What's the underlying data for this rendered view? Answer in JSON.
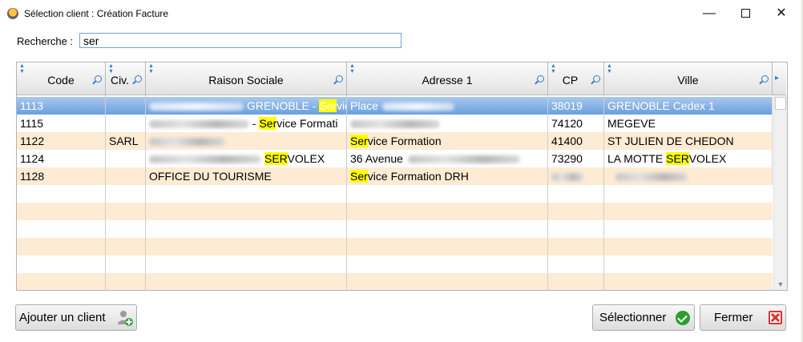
{
  "window": {
    "title": "Sélection client : Création Facture",
    "minimize_glyph": "—",
    "close_glyph": "✕"
  },
  "search": {
    "label": "Recherche :",
    "value": "ser"
  },
  "grid": {
    "columns": [
      {
        "key": "code",
        "label": "Code"
      },
      {
        "key": "civ",
        "label": "Civ."
      },
      {
        "key": "raison",
        "label": "Raison Sociale"
      },
      {
        "key": "adresse",
        "label": "Adresse 1"
      },
      {
        "key": "cp",
        "label": "CP"
      },
      {
        "key": "ville",
        "label": "Ville"
      }
    ],
    "rows": [
      {
        "code": "1113",
        "civ": "",
        "raison": {
          "pre": "GRENOBLE - ",
          "hl": "Ser",
          "post": "vic"
        },
        "adresse": {
          "pre": "Place",
          "hl": "",
          "post": ""
        },
        "cp": "38019",
        "ville": {
          "pre": "GRENOBLE Cedex 1",
          "hl": "",
          "post": ""
        },
        "selected": true
      },
      {
        "code": "1115",
        "civ": "",
        "raison": {
          "pre": " - ",
          "hl": "Ser",
          "post": "vice Formati"
        },
        "adresse": {
          "pre": "",
          "hl": "",
          "post": ""
        },
        "cp": "74120",
        "ville": {
          "pre": "MEGEVE",
          "hl": "",
          "post": ""
        },
        "selected": false
      },
      {
        "code": "1122",
        "civ": "SARL",
        "raison": {
          "pre": "",
          "hl": "",
          "post": ""
        },
        "adresse": {
          "pre": "",
          "hl": "Ser",
          "post": "vice Formation"
        },
        "cp": "41400",
        "ville": {
          "pre": "ST JULIEN DE CHEDON",
          "hl": "",
          "post": ""
        },
        "selected": false
      },
      {
        "code": "1124",
        "civ": "",
        "raison": {
          "pre": "",
          "hl": "SER",
          "post": "VOLEX"
        },
        "adresse": {
          "pre": "36 Avenue",
          "hl": "",
          "post": ""
        },
        "cp": "73290",
        "ville": {
          "pre": "LA MOTTE ",
          "hl": "SER",
          "post": "VOLEX"
        },
        "selected": false
      },
      {
        "code": "1128",
        "civ": "",
        "raison": {
          "pre": "OFFICE DU TOURISME",
          "hl": "",
          "post": ""
        },
        "adresse": {
          "pre": "",
          "hl": "Ser",
          "post": "vice Formation DRH"
        },
        "cp": "",
        "ville": {
          "pre": "",
          "hl": "",
          "post": ""
        },
        "selected": false
      }
    ]
  },
  "buttons": {
    "add_client": "Ajouter un client",
    "select": "Sélectionner",
    "close": "Fermer"
  },
  "icons": {
    "add_user": "add-user-icon",
    "select": "check-circle-icon",
    "close": "red-x-icon"
  },
  "colors": {
    "selected_row": "#6a9fdc",
    "stripe": "#fdebd3",
    "highlight": "#ffff00",
    "search_border": "#6aa6d8"
  }
}
